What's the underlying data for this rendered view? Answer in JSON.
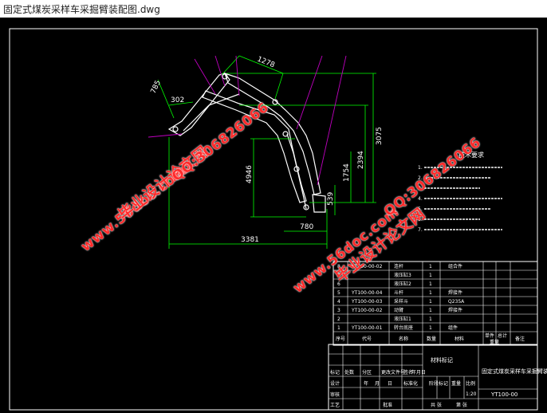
{
  "window": {
    "title": "固定式煤炭采样车采掘臂装配图.dwg"
  },
  "colors": {
    "background": "#000000",
    "line": "#ffffff",
    "dimension": "#00ff00",
    "leader": "#c000c0",
    "watermark": "#ff2a2a"
  },
  "dimensions": {
    "top": "1278",
    "upper_left": "785",
    "left_small": "302",
    "height_right": "3075",
    "height_mid": "2394",
    "height_inner": "1754",
    "left_vertical": "4946",
    "small_right": "539",
    "base_width": "3381",
    "base_small": "780"
  },
  "tech_requirements": {
    "heading": "技术要求",
    "lines": [
      "1.",
      "2.",
      "3.",
      "4.",
      "5.",
      "6.",
      "7."
    ]
  },
  "parts": [
    {
      "no": "8",
      "code": "YT100-00-02",
      "name": "连杆",
      "qty": "1",
      "material": "组合件"
    },
    {
      "no": "7",
      "code": "",
      "name": "液压缸3",
      "qty": "1",
      "material": ""
    },
    {
      "no": "6",
      "code": "",
      "name": "液压缸2",
      "qty": "1",
      "material": ""
    },
    {
      "no": "5",
      "code": "YT100-00-04",
      "name": "斗杆",
      "qty": "1",
      "material": "焊接件"
    },
    {
      "no": "4",
      "code": "YT100-00-03",
      "name": "采样斗",
      "qty": "1",
      "material": "Q235A"
    },
    {
      "no": "3",
      "code": "YT100-00-02",
      "name": "动臂",
      "qty": "1",
      "material": "焊接件"
    },
    {
      "no": "2",
      "code": "",
      "name": "液压缸1",
      "qty": "1",
      "material": ""
    },
    {
      "no": "1",
      "code": "YT100-00-01",
      "name": "转台底座",
      "qty": "1",
      "material": "组件"
    }
  ],
  "parts_header": {
    "no": "序号",
    "code": "代号",
    "name": "名称",
    "qty": "数量",
    "material": "材料",
    "unit": "单件",
    "total": "总计",
    "weight": "重量",
    "remark": "备注"
  },
  "title_block": {
    "material_label": "材料标记",
    "drawing_title": "固定式煤炭采样车采掘臂装配图",
    "drawing_code": "YT100-00",
    "sign_row": [
      "标记",
      "处数",
      "分区",
      "更改文件号",
      "签名",
      "年月日"
    ],
    "design_row": [
      "设计",
      "年",
      "月",
      "日",
      "标准化"
    ],
    "stage": "阶段标记",
    "weight": "重量",
    "scale": "比例",
    "scale_value": "1:20",
    "review": "审核",
    "process": "工艺",
    "approve": "批准",
    "sheets": "共  张",
    "sheet_no": "第  张"
  },
  "watermarks": {
    "url": "www.56doc.com",
    "name": "毕业设计论文网",
    "qq": "QQ:306826066"
  }
}
